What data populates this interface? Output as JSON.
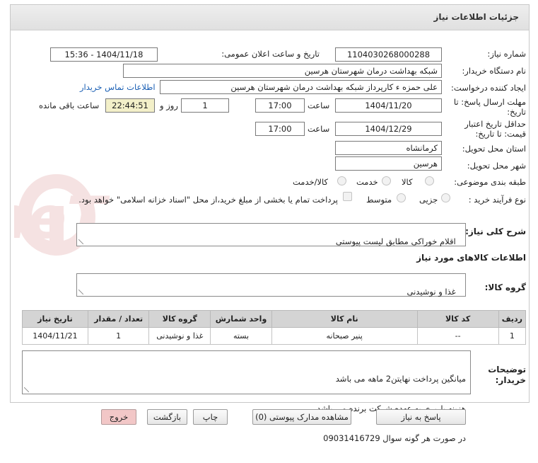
{
  "header": {
    "title": "جزئیات اطلاعات نیاز"
  },
  "form": {
    "need_number": {
      "label": "شماره نیاز:",
      "value": "1104030268000288"
    },
    "announce": {
      "label": "تاریخ و ساعت اعلان عمومی:",
      "value": "1404/11/18 - 15:36"
    },
    "buyer_org": {
      "label": "نام دستگاه خریدار:",
      "value": "شبکه بهداشت درمان شهرستان هرسین"
    },
    "requester": {
      "label": "ایجاد کننده درخواست:",
      "value": "علی حمزه ء کارپرداز شبکه بهداشت درمان شهرستان هرسین",
      "contact_link": "اطلاعات تماس خریدار"
    },
    "deadline": {
      "label_line1": "مهلت ارسال پاسخ: تا",
      "label_line2": "تاریخ:",
      "date": "1404/11/20",
      "time_label": "ساعت",
      "time": "17:00",
      "days": "1",
      "days_label": "روز و",
      "remaining": "22:44:51",
      "remaining_label": "ساعت باقی مانده"
    },
    "validity": {
      "label_line1": "حداقل تاریخ اعتبار",
      "label_line2": "قیمت: تا تاریخ:",
      "date": "1404/12/29",
      "time_label": "ساعت",
      "time": "17:00"
    },
    "province": {
      "label": "استان محل تحویل:",
      "value": "کرمانشاه"
    },
    "city": {
      "label": "شهر محل تحویل:",
      "value": "هرسین"
    },
    "category": {
      "label": "طبقه بندی موضوعی:",
      "options": [
        "کالا",
        "خدمت",
        "کالا/خدمت"
      ]
    },
    "process": {
      "label": "نوع فرآیند خرید :",
      "options": [
        "جزیی",
        "متوسط"
      ],
      "payment_note": "پرداخت تمام یا بخشی از مبلغ خرید،از محل \"اسناد خزانه اسلامی\" خواهد بود."
    }
  },
  "description": {
    "label": "شرح کلی نیاز:",
    "value": "اقلام خوراکی مطابق لیست پیوستی"
  },
  "goods_section": {
    "title": "اطلاعات کالاهای مورد نیاز"
  },
  "goods_group": {
    "label": "گروه کالا:",
    "value": "غذا و نوشیدنی"
  },
  "table": {
    "headers": [
      "ردیف",
      "کد کالا",
      "نام کالا",
      "واحد شمارش",
      "گروه کالا",
      "تعداد / مقدار",
      "تاریخ نیاز"
    ],
    "rows": [
      [
        "1",
        "--",
        "پنیر صبحانه",
        "بسته",
        "غذا و نوشیدنی",
        "1",
        "1404/11/21"
      ]
    ]
  },
  "buyer_notes": {
    "label_line1": "توضیحات",
    "label_line2": "خریدار:",
    "lines": [
      "میانگین پرداخت نهایتن2 ماهه می باشد",
      "هزینه باربری به عهده شرکت برنده می باشد",
      "در صورت هر گونه سوال 09031416729"
    ]
  },
  "watermark": {
    "text": "AriaTender.neT"
  },
  "buttons": {
    "reply": "پاسخ به نیاز",
    "attachments": "مشاهده مدارک پیوستی (0)",
    "print": "چاپ",
    "back": "بازگشت",
    "exit": "خروج"
  },
  "colors": {
    "header_bg": "#e4e4e4",
    "link": "#1a5fb4",
    "time_bg": "#f3f0c9",
    "exit_bg": "#f2c7c7"
  }
}
